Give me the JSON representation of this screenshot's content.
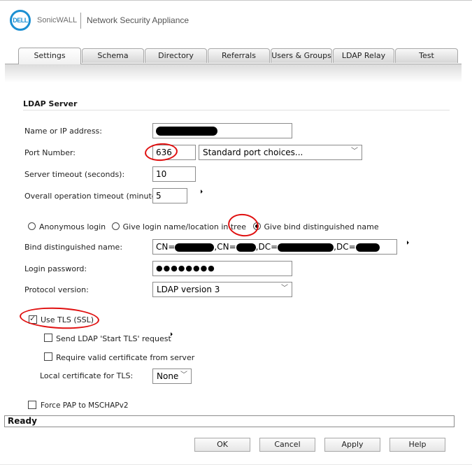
{
  "header": {
    "logo_text": "DELL",
    "brand": "SonicWALL",
    "product": "Network Security Appliance"
  },
  "tabs": [
    {
      "label": "Settings",
      "active": true
    },
    {
      "label": "Schema",
      "active": false
    },
    {
      "label": "Directory",
      "active": false
    },
    {
      "label": "Referrals",
      "active": false
    },
    {
      "label": "Users & Groups",
      "active": false
    },
    {
      "label": "LDAP Relay",
      "active": false
    },
    {
      "label": "Test",
      "active": false
    }
  ],
  "section": {
    "title": "LDAP Server"
  },
  "fields": {
    "name_ip": {
      "label": "Name or IP address:",
      "value": "[redacted]"
    },
    "port": {
      "label": "Port Number:",
      "value": "636",
      "choices_selected": "Standard port choices..."
    },
    "server_timeout": {
      "label": "Server timeout (seconds):",
      "value": "10"
    },
    "operation_timeout": {
      "label": "Overall operation timeout (minutes):",
      "value": "5"
    },
    "login_mode": {
      "options": [
        {
          "label": "Anonymous login",
          "selected": false
        },
        {
          "label": "Give login name/location in tree",
          "selected": false
        },
        {
          "label": "Give bind distinguished name",
          "selected": true
        }
      ]
    },
    "bind_dn": {
      "label": "Bind distinguished name:",
      "parts": [
        "CN=",
        ",CN=",
        ",DC=",
        ",DC="
      ]
    },
    "login_password": {
      "label": "Login password:",
      "value": "●●●●●●●●"
    },
    "protocol_version": {
      "label": "Protocol version:",
      "value": "LDAP version 3"
    },
    "use_tls": {
      "label": "Use TLS (SSL)",
      "checked": true
    },
    "start_tls": {
      "label": "Send LDAP 'Start TLS' request",
      "checked": false
    },
    "require_cert": {
      "label": "Require valid certificate from server",
      "checked": false
    },
    "local_cert": {
      "label": "Local certificate for TLS:",
      "value": "None"
    },
    "force_pap": {
      "label": "Force PAP to MSCHAPv2",
      "checked": false
    }
  },
  "status": {
    "text": "Ready"
  },
  "buttons": {
    "ok": "OK",
    "cancel": "Cancel",
    "apply": "Apply",
    "help": "Help"
  },
  "colors": {
    "brand_blue": "#1b8fd2",
    "annotation_red": "#e01010"
  }
}
